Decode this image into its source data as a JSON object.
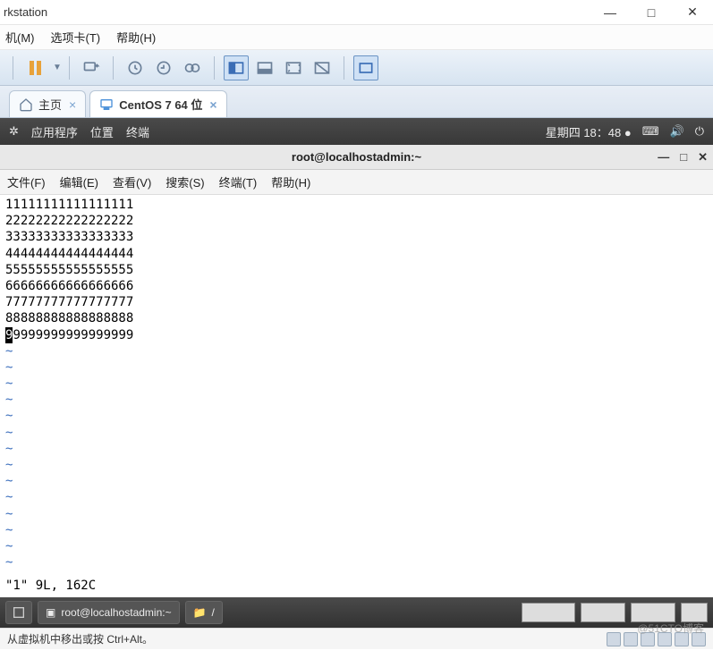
{
  "window": {
    "title_fragment": "rkstation",
    "minimize": "—",
    "maximize": "□",
    "close": "✕"
  },
  "menubar": {
    "items": [
      "机(M)",
      "选项卡(T)",
      "帮助(H)"
    ]
  },
  "tabs": [
    {
      "label": "主页",
      "icon": "home",
      "close": "×"
    },
    {
      "label": "CentOS 7 64 位",
      "icon": "vm",
      "close": "×",
      "active": true
    }
  ],
  "vm_topbar": {
    "apps_label": "应用程序",
    "location_label": "位置",
    "terminal_label": "终端",
    "datetime": "星期四 18：48",
    "dot": "●"
  },
  "vm_window": {
    "title": "root@localhostadmin:~",
    "minimize": "—",
    "maximize": "□",
    "close": "✕"
  },
  "term_menu": {
    "items": [
      "文件(F)",
      "编辑(E)",
      "查看(V)",
      "搜索(S)",
      "终端(T)",
      "帮助(H)"
    ]
  },
  "term": {
    "lines": [
      "11111111111111111",
      "22222222222222222",
      "33333333333333333",
      "44444444444444444",
      "55555555555555555",
      "66666666666666666",
      "77777777777777777",
      "88888888888888888"
    ],
    "cursor_line_prefix": "9",
    "cursor_line_rest": "9999999999999999",
    "tilde": "~",
    "status": "\"1\" 9L, 162C"
  },
  "vm_taskbar": {
    "task1": "root@localhostadmin:~",
    "task2_path": "/"
  },
  "statusbar": {
    "hint": "从虚拟机中移出或按 Ctrl+Alt。"
  },
  "watermark": "@51CTO博客"
}
